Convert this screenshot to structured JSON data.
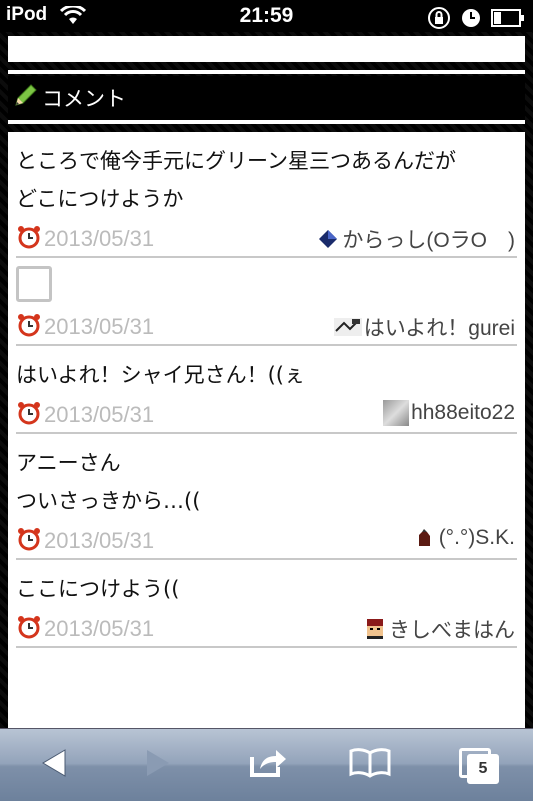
{
  "status_bar": {
    "carrier": "iPod",
    "time": "21:59"
  },
  "section": {
    "title": "コメント"
  },
  "comments": [
    {
      "text": "ところで俺今手元にグリーン星三つあるんだが\nどこにつけようか",
      "date": "2013/05/31",
      "user": "からっし(OラO　)"
    },
    {
      "text": "",
      "date": "2013/05/31",
      "user": "はいよれ！gurei"
    },
    {
      "text": "はいよれ！シャイ兄さん！((ぇ",
      "date": "2013/05/31",
      "user": "hh88eito22"
    },
    {
      "text": "アニーさん\nついさっきから…((",
      "date": "2013/05/31",
      "user": "(°.°)S.K."
    },
    {
      "text": "ここにつけよう((",
      "date": "2013/05/31",
      "user": "きしべまはん"
    }
  ],
  "toolbar": {
    "tabs_count": "5"
  }
}
